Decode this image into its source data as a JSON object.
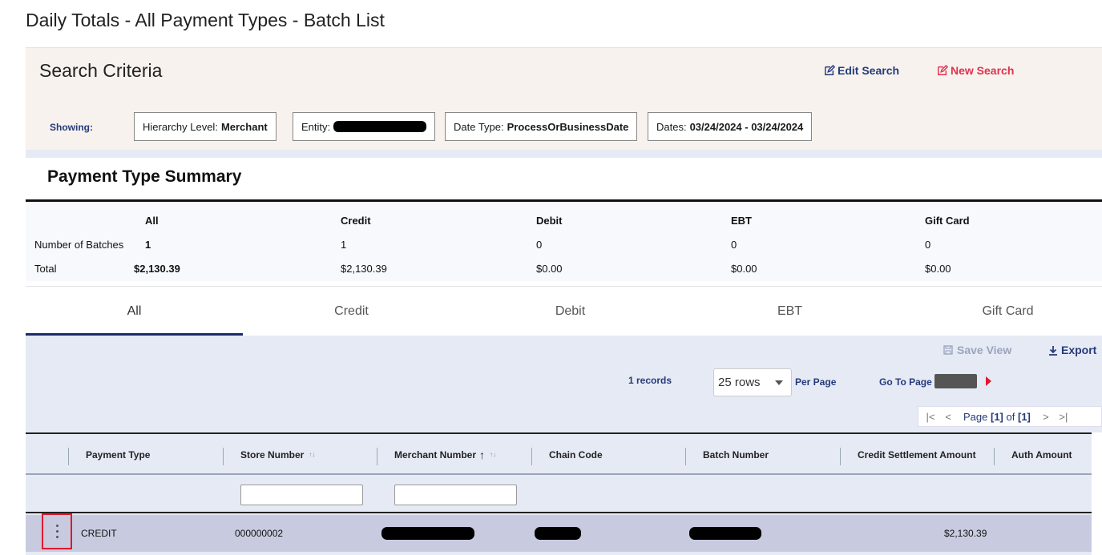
{
  "page": {
    "title": "Daily Totals - All Payment Types - Batch List"
  },
  "criteria": {
    "title": "Search Criteria",
    "edit_search": "Edit Search",
    "new_search": "New Search",
    "showing_label": "Showing:",
    "chips": {
      "hierarchy_label": "Hierarchy Level:",
      "hierarchy_value": "Merchant",
      "entity_label": "Entity:",
      "date_type_label": "Date Type:",
      "date_type_value": "ProcessOrBusinessDate",
      "dates_label": "Dates:",
      "dates_value": "03/24/2024 - 03/24/2024"
    }
  },
  "summary": {
    "title": "Payment Type Summary",
    "columns": [
      "All",
      "Credit",
      "Debit",
      "EBT",
      "Gift Card"
    ],
    "rows": [
      {
        "label": "Number of Batches",
        "values": [
          "1",
          "1",
          "0",
          "0",
          "0"
        ]
      },
      {
        "label": "Total",
        "values": [
          "$2,130.39",
          "$2,130.39",
          "$0.00",
          "$0.00",
          "$0.00"
        ]
      }
    ]
  },
  "tabs": [
    {
      "label": "All",
      "active": true
    },
    {
      "label": "Credit",
      "active": false
    },
    {
      "label": "Debit",
      "active": false
    },
    {
      "label": "EBT",
      "active": false
    },
    {
      "label": "Gift Card",
      "active": false
    }
  ],
  "toolbar": {
    "save_view": "Save View",
    "export": "Export",
    "records": "1 records",
    "rows_value": "25 rows",
    "per_page": "Per Page",
    "go_to_page": "Go To Page",
    "page_prefix": "Page",
    "page_current": "[1]",
    "page_of": "of",
    "page_total": "[1]"
  },
  "grid": {
    "columns": [
      "Payment Type",
      "Store Number",
      "Merchant Number",
      "Chain Code",
      "Batch Number",
      "Credit Settlement Amount",
      "Auth Amount"
    ],
    "rows": [
      {
        "payment_type": "CREDIT",
        "store_number": "000000002",
        "credit_settlement_amount": "$2,130.39"
      }
    ]
  },
  "colors": {
    "accent": "#253a7a",
    "danger": "#e0314f",
    "tab_underline": "#1d2a6b",
    "row_highlight": "#c8cbe0"
  }
}
